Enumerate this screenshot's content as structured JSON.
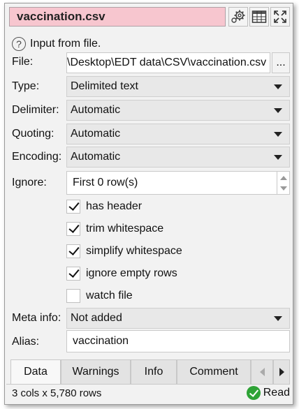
{
  "title": "vaccination.csv",
  "toolbar": {
    "icons": [
      "gear-icon",
      "table-icon",
      "expand-icon"
    ]
  },
  "info_text": "Input from file.",
  "file": {
    "label": "File:",
    "value": "\\Desktop\\EDT data\\CSV\\vaccination.csv",
    "browse_label": "..."
  },
  "type": {
    "label": "Type:",
    "value": "Delimited text"
  },
  "delimiter": {
    "label": "Delimiter:",
    "value": "Automatic"
  },
  "quoting": {
    "label": "Quoting:",
    "value": "Automatic"
  },
  "encoding": {
    "label": "Encoding:",
    "value": "Automatic"
  },
  "ignore": {
    "label": "Ignore:",
    "value": "First 0 row(s)"
  },
  "options": [
    {
      "label": "has header",
      "checked": true
    },
    {
      "label": "trim whitespace",
      "checked": true
    },
    {
      "label": "simplify whitespace",
      "checked": true
    },
    {
      "label": "ignore empty rows",
      "checked": true
    },
    {
      "label": "watch file",
      "checked": false
    }
  ],
  "meta": {
    "label": "Meta info:",
    "value": "Not added"
  },
  "alias": {
    "label": "Alias:",
    "value": "vaccination"
  },
  "tabs": [
    "Data",
    "Warnings",
    "Info",
    "Comment"
  ],
  "status": {
    "summary": "3 cols x 5,780 rows",
    "state": "Read"
  },
  "colors": {
    "title_bg": "#f7c6cf",
    "ok_green": "#2ea336"
  }
}
